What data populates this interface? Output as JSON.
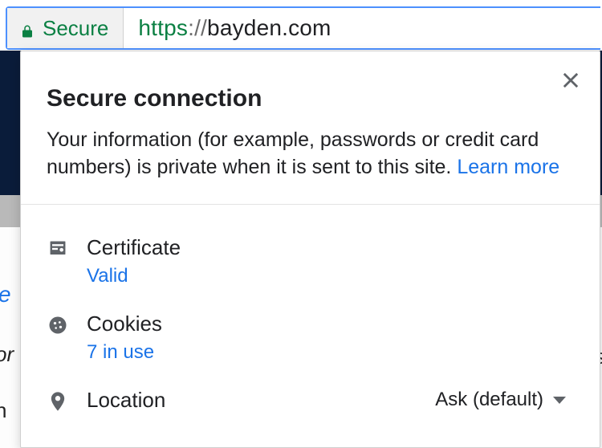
{
  "omnibox": {
    "secure_label": "Secure",
    "scheme": "https",
    "sep": "://",
    "host": "bayden.com"
  },
  "popup": {
    "title": "Secure connection",
    "description": "Your information (for example, passwords or credit card numbers) is private when it is sent to this site. ",
    "learn_more": "Learn more",
    "certificate": {
      "label": "Certificate",
      "status": "Valid"
    },
    "cookies": {
      "label": "Cookies",
      "status": "7 in use"
    },
    "location": {
      "label": "Location",
      "value": "Ask (default)"
    }
  },
  "background_peeks": {
    "a": "e",
    "b": "or",
    "c": "h",
    "d": "s"
  }
}
